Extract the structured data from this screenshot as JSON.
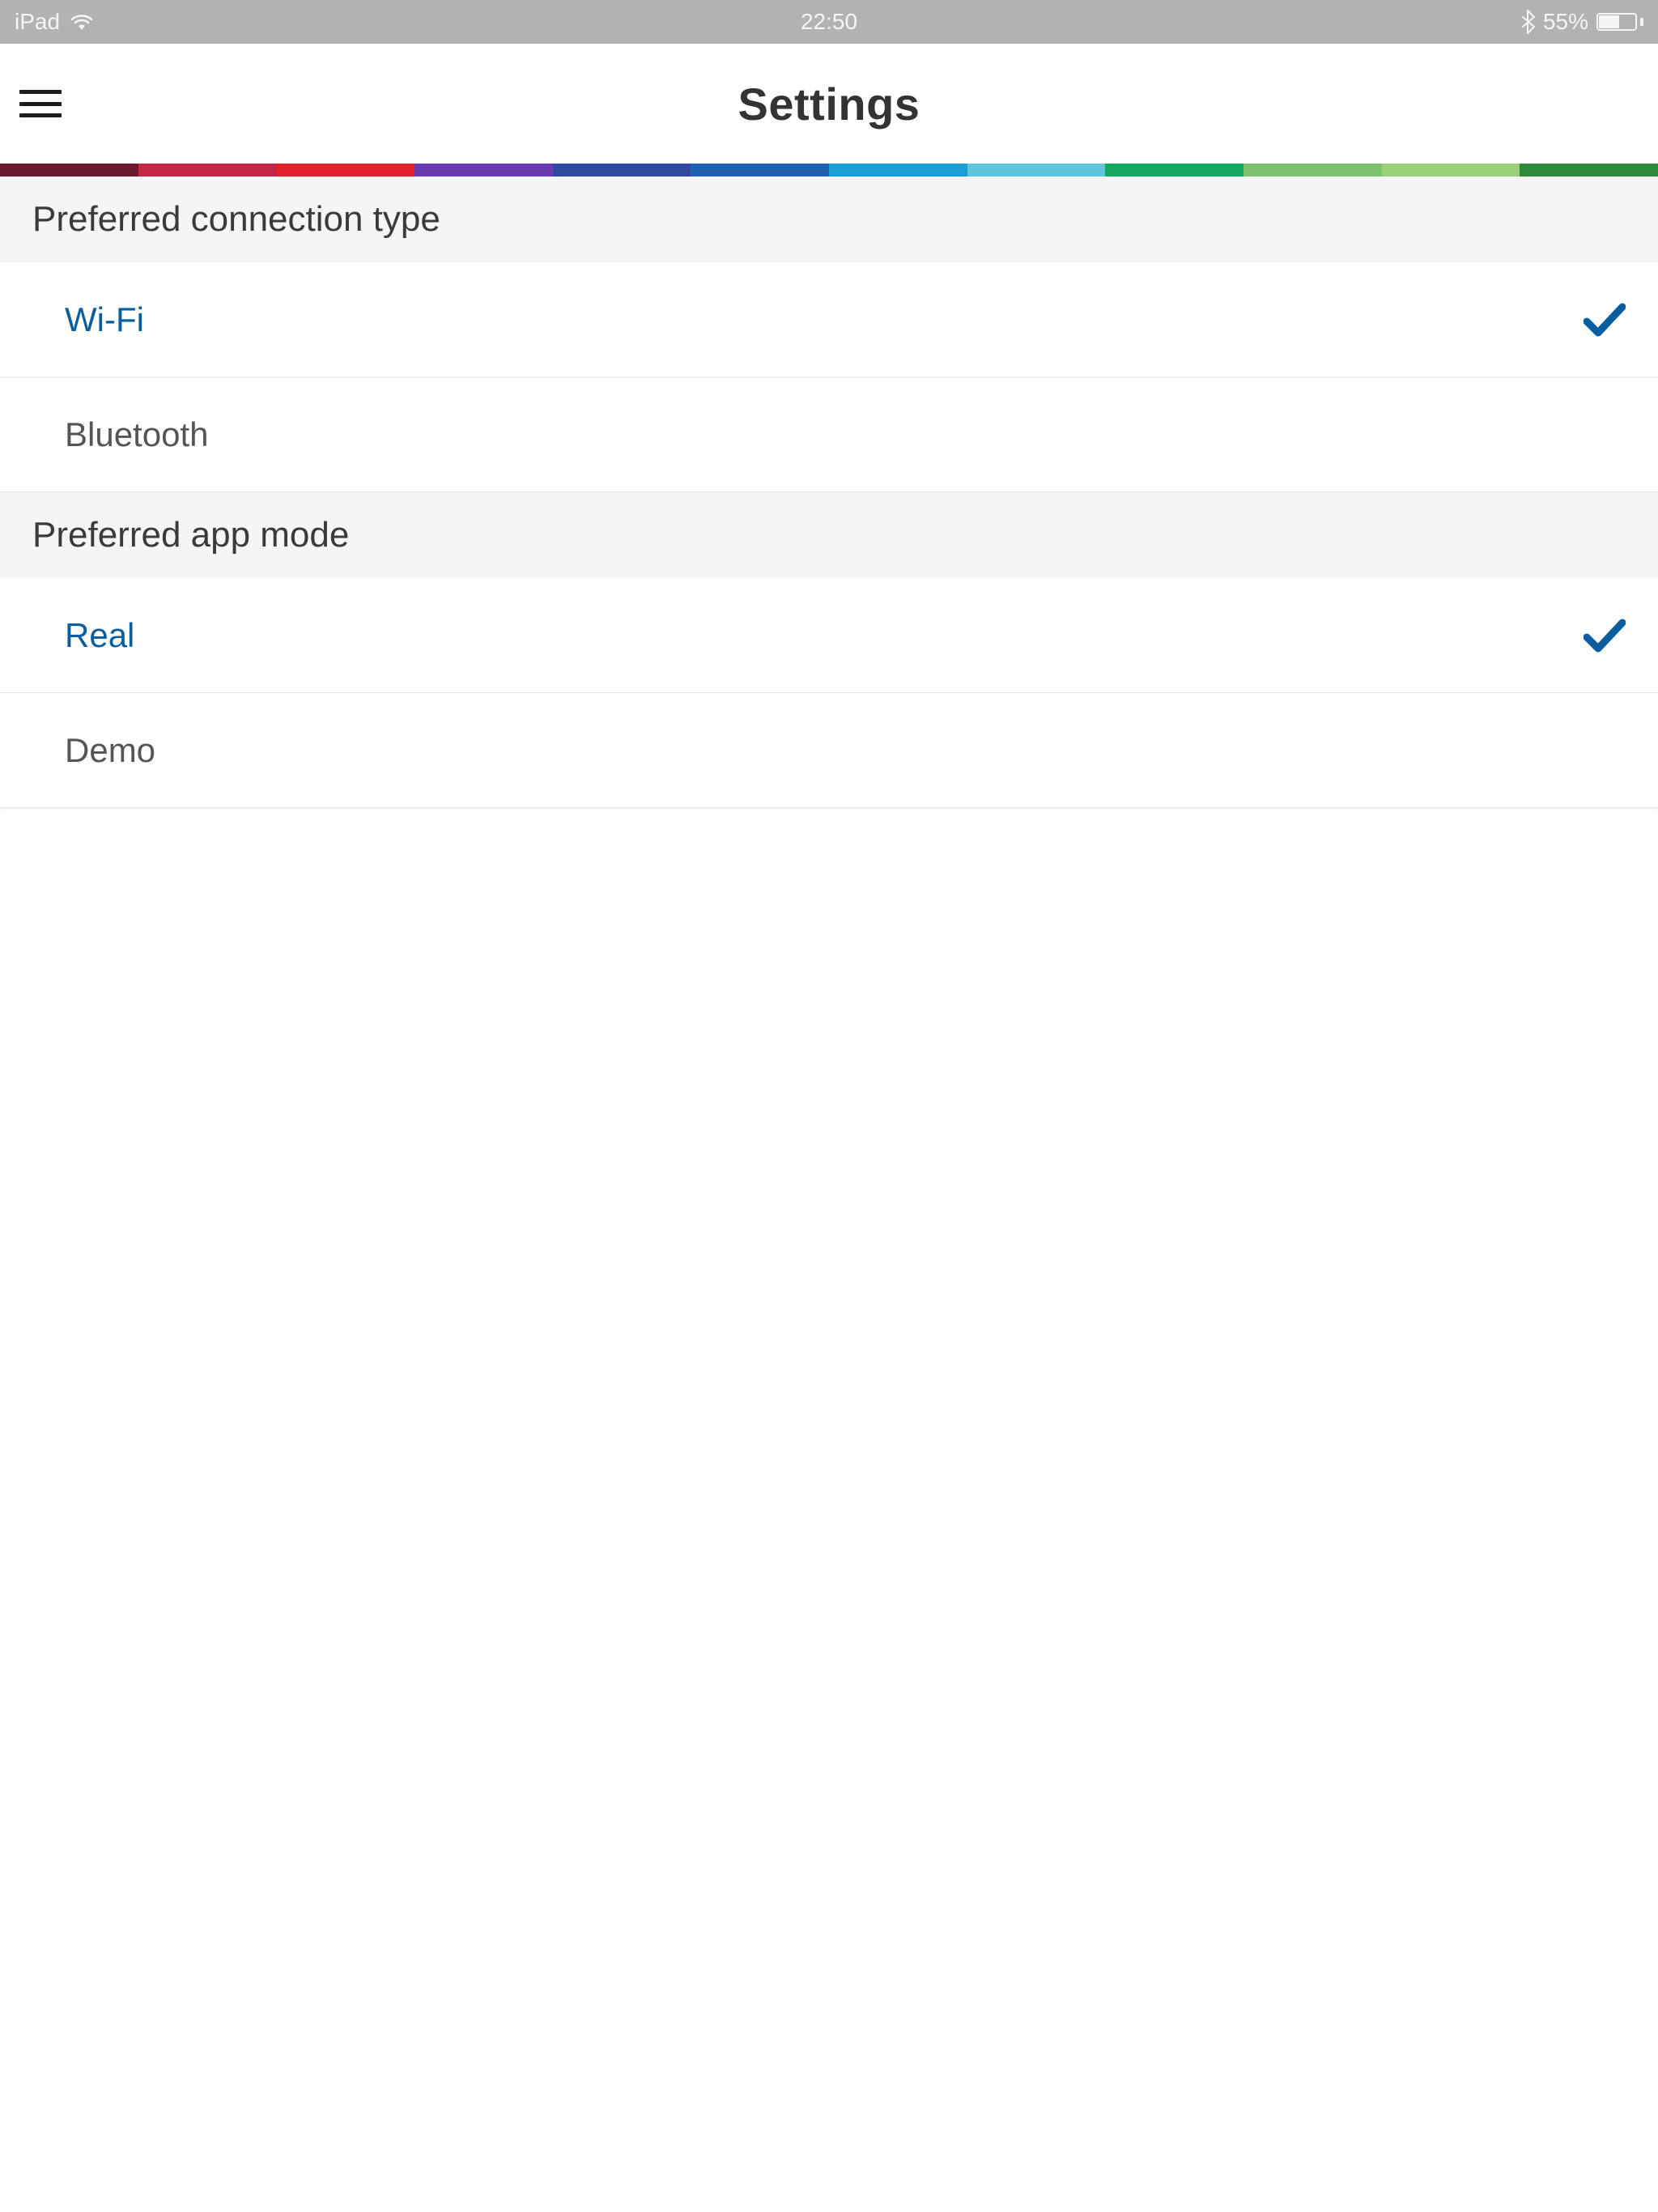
{
  "status_bar": {
    "device": "iPad",
    "time": "22:50",
    "battery_percent": "55%"
  },
  "header": {
    "title": "Settings"
  },
  "color_strip": [
    "#6a1a31",
    "#c22846",
    "#e0222a",
    "#6a3bb0",
    "#2e4aa0",
    "#1f60b0",
    "#1a9fd4",
    "#5ec6dc",
    "#14a860",
    "#7cc26e",
    "#9ad07a",
    "#2e8a3a"
  ],
  "sections": [
    {
      "title": "Preferred connection type",
      "items": [
        {
          "label": "Wi-Fi",
          "selected": true
        },
        {
          "label": "Bluetooth",
          "selected": false
        }
      ]
    },
    {
      "title": "Preferred app mode",
      "items": [
        {
          "label": "Real",
          "selected": true
        },
        {
          "label": "Demo",
          "selected": false
        }
      ]
    }
  ],
  "colors": {
    "accent": "#0a5ea0"
  }
}
